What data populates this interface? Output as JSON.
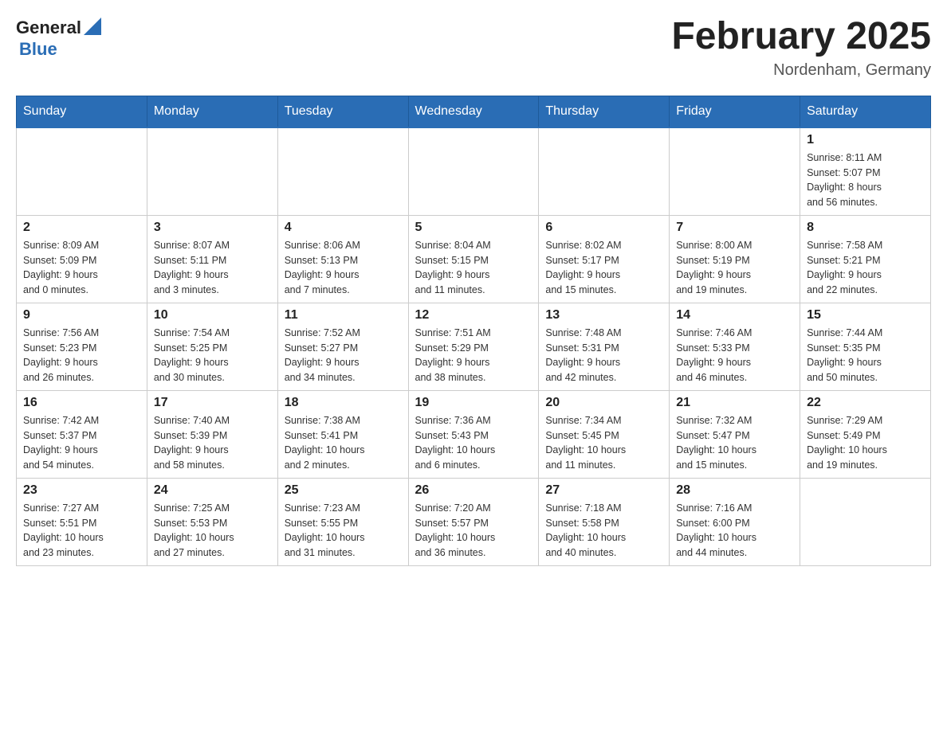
{
  "header": {
    "logo": {
      "general": "General",
      "blue": "Blue"
    },
    "title": "February 2025",
    "location": "Nordenham, Germany"
  },
  "weekdays": [
    "Sunday",
    "Monday",
    "Tuesday",
    "Wednesday",
    "Thursday",
    "Friday",
    "Saturday"
  ],
  "weeks": [
    [
      {
        "day": "",
        "info": ""
      },
      {
        "day": "",
        "info": ""
      },
      {
        "day": "",
        "info": ""
      },
      {
        "day": "",
        "info": ""
      },
      {
        "day": "",
        "info": ""
      },
      {
        "day": "",
        "info": ""
      },
      {
        "day": "1",
        "info": "Sunrise: 8:11 AM\nSunset: 5:07 PM\nDaylight: 8 hours\nand 56 minutes."
      }
    ],
    [
      {
        "day": "2",
        "info": "Sunrise: 8:09 AM\nSunset: 5:09 PM\nDaylight: 9 hours\nand 0 minutes."
      },
      {
        "day": "3",
        "info": "Sunrise: 8:07 AM\nSunset: 5:11 PM\nDaylight: 9 hours\nand 3 minutes."
      },
      {
        "day": "4",
        "info": "Sunrise: 8:06 AM\nSunset: 5:13 PM\nDaylight: 9 hours\nand 7 minutes."
      },
      {
        "day": "5",
        "info": "Sunrise: 8:04 AM\nSunset: 5:15 PM\nDaylight: 9 hours\nand 11 minutes."
      },
      {
        "day": "6",
        "info": "Sunrise: 8:02 AM\nSunset: 5:17 PM\nDaylight: 9 hours\nand 15 minutes."
      },
      {
        "day": "7",
        "info": "Sunrise: 8:00 AM\nSunset: 5:19 PM\nDaylight: 9 hours\nand 19 minutes."
      },
      {
        "day": "8",
        "info": "Sunrise: 7:58 AM\nSunset: 5:21 PM\nDaylight: 9 hours\nand 22 minutes."
      }
    ],
    [
      {
        "day": "9",
        "info": "Sunrise: 7:56 AM\nSunset: 5:23 PM\nDaylight: 9 hours\nand 26 minutes."
      },
      {
        "day": "10",
        "info": "Sunrise: 7:54 AM\nSunset: 5:25 PM\nDaylight: 9 hours\nand 30 minutes."
      },
      {
        "day": "11",
        "info": "Sunrise: 7:52 AM\nSunset: 5:27 PM\nDaylight: 9 hours\nand 34 minutes."
      },
      {
        "day": "12",
        "info": "Sunrise: 7:51 AM\nSunset: 5:29 PM\nDaylight: 9 hours\nand 38 minutes."
      },
      {
        "day": "13",
        "info": "Sunrise: 7:48 AM\nSunset: 5:31 PM\nDaylight: 9 hours\nand 42 minutes."
      },
      {
        "day": "14",
        "info": "Sunrise: 7:46 AM\nSunset: 5:33 PM\nDaylight: 9 hours\nand 46 minutes."
      },
      {
        "day": "15",
        "info": "Sunrise: 7:44 AM\nSunset: 5:35 PM\nDaylight: 9 hours\nand 50 minutes."
      }
    ],
    [
      {
        "day": "16",
        "info": "Sunrise: 7:42 AM\nSunset: 5:37 PM\nDaylight: 9 hours\nand 54 minutes."
      },
      {
        "day": "17",
        "info": "Sunrise: 7:40 AM\nSunset: 5:39 PM\nDaylight: 9 hours\nand 58 minutes."
      },
      {
        "day": "18",
        "info": "Sunrise: 7:38 AM\nSunset: 5:41 PM\nDaylight: 10 hours\nand 2 minutes."
      },
      {
        "day": "19",
        "info": "Sunrise: 7:36 AM\nSunset: 5:43 PM\nDaylight: 10 hours\nand 6 minutes."
      },
      {
        "day": "20",
        "info": "Sunrise: 7:34 AM\nSunset: 5:45 PM\nDaylight: 10 hours\nand 11 minutes."
      },
      {
        "day": "21",
        "info": "Sunrise: 7:32 AM\nSunset: 5:47 PM\nDaylight: 10 hours\nand 15 minutes."
      },
      {
        "day": "22",
        "info": "Sunrise: 7:29 AM\nSunset: 5:49 PM\nDaylight: 10 hours\nand 19 minutes."
      }
    ],
    [
      {
        "day": "23",
        "info": "Sunrise: 7:27 AM\nSunset: 5:51 PM\nDaylight: 10 hours\nand 23 minutes."
      },
      {
        "day": "24",
        "info": "Sunrise: 7:25 AM\nSunset: 5:53 PM\nDaylight: 10 hours\nand 27 minutes."
      },
      {
        "day": "25",
        "info": "Sunrise: 7:23 AM\nSunset: 5:55 PM\nDaylight: 10 hours\nand 31 minutes."
      },
      {
        "day": "26",
        "info": "Sunrise: 7:20 AM\nSunset: 5:57 PM\nDaylight: 10 hours\nand 36 minutes."
      },
      {
        "day": "27",
        "info": "Sunrise: 7:18 AM\nSunset: 5:58 PM\nDaylight: 10 hours\nand 40 minutes."
      },
      {
        "day": "28",
        "info": "Sunrise: 7:16 AM\nSunset: 6:00 PM\nDaylight: 10 hours\nand 44 minutes."
      },
      {
        "day": "",
        "info": ""
      }
    ]
  ]
}
